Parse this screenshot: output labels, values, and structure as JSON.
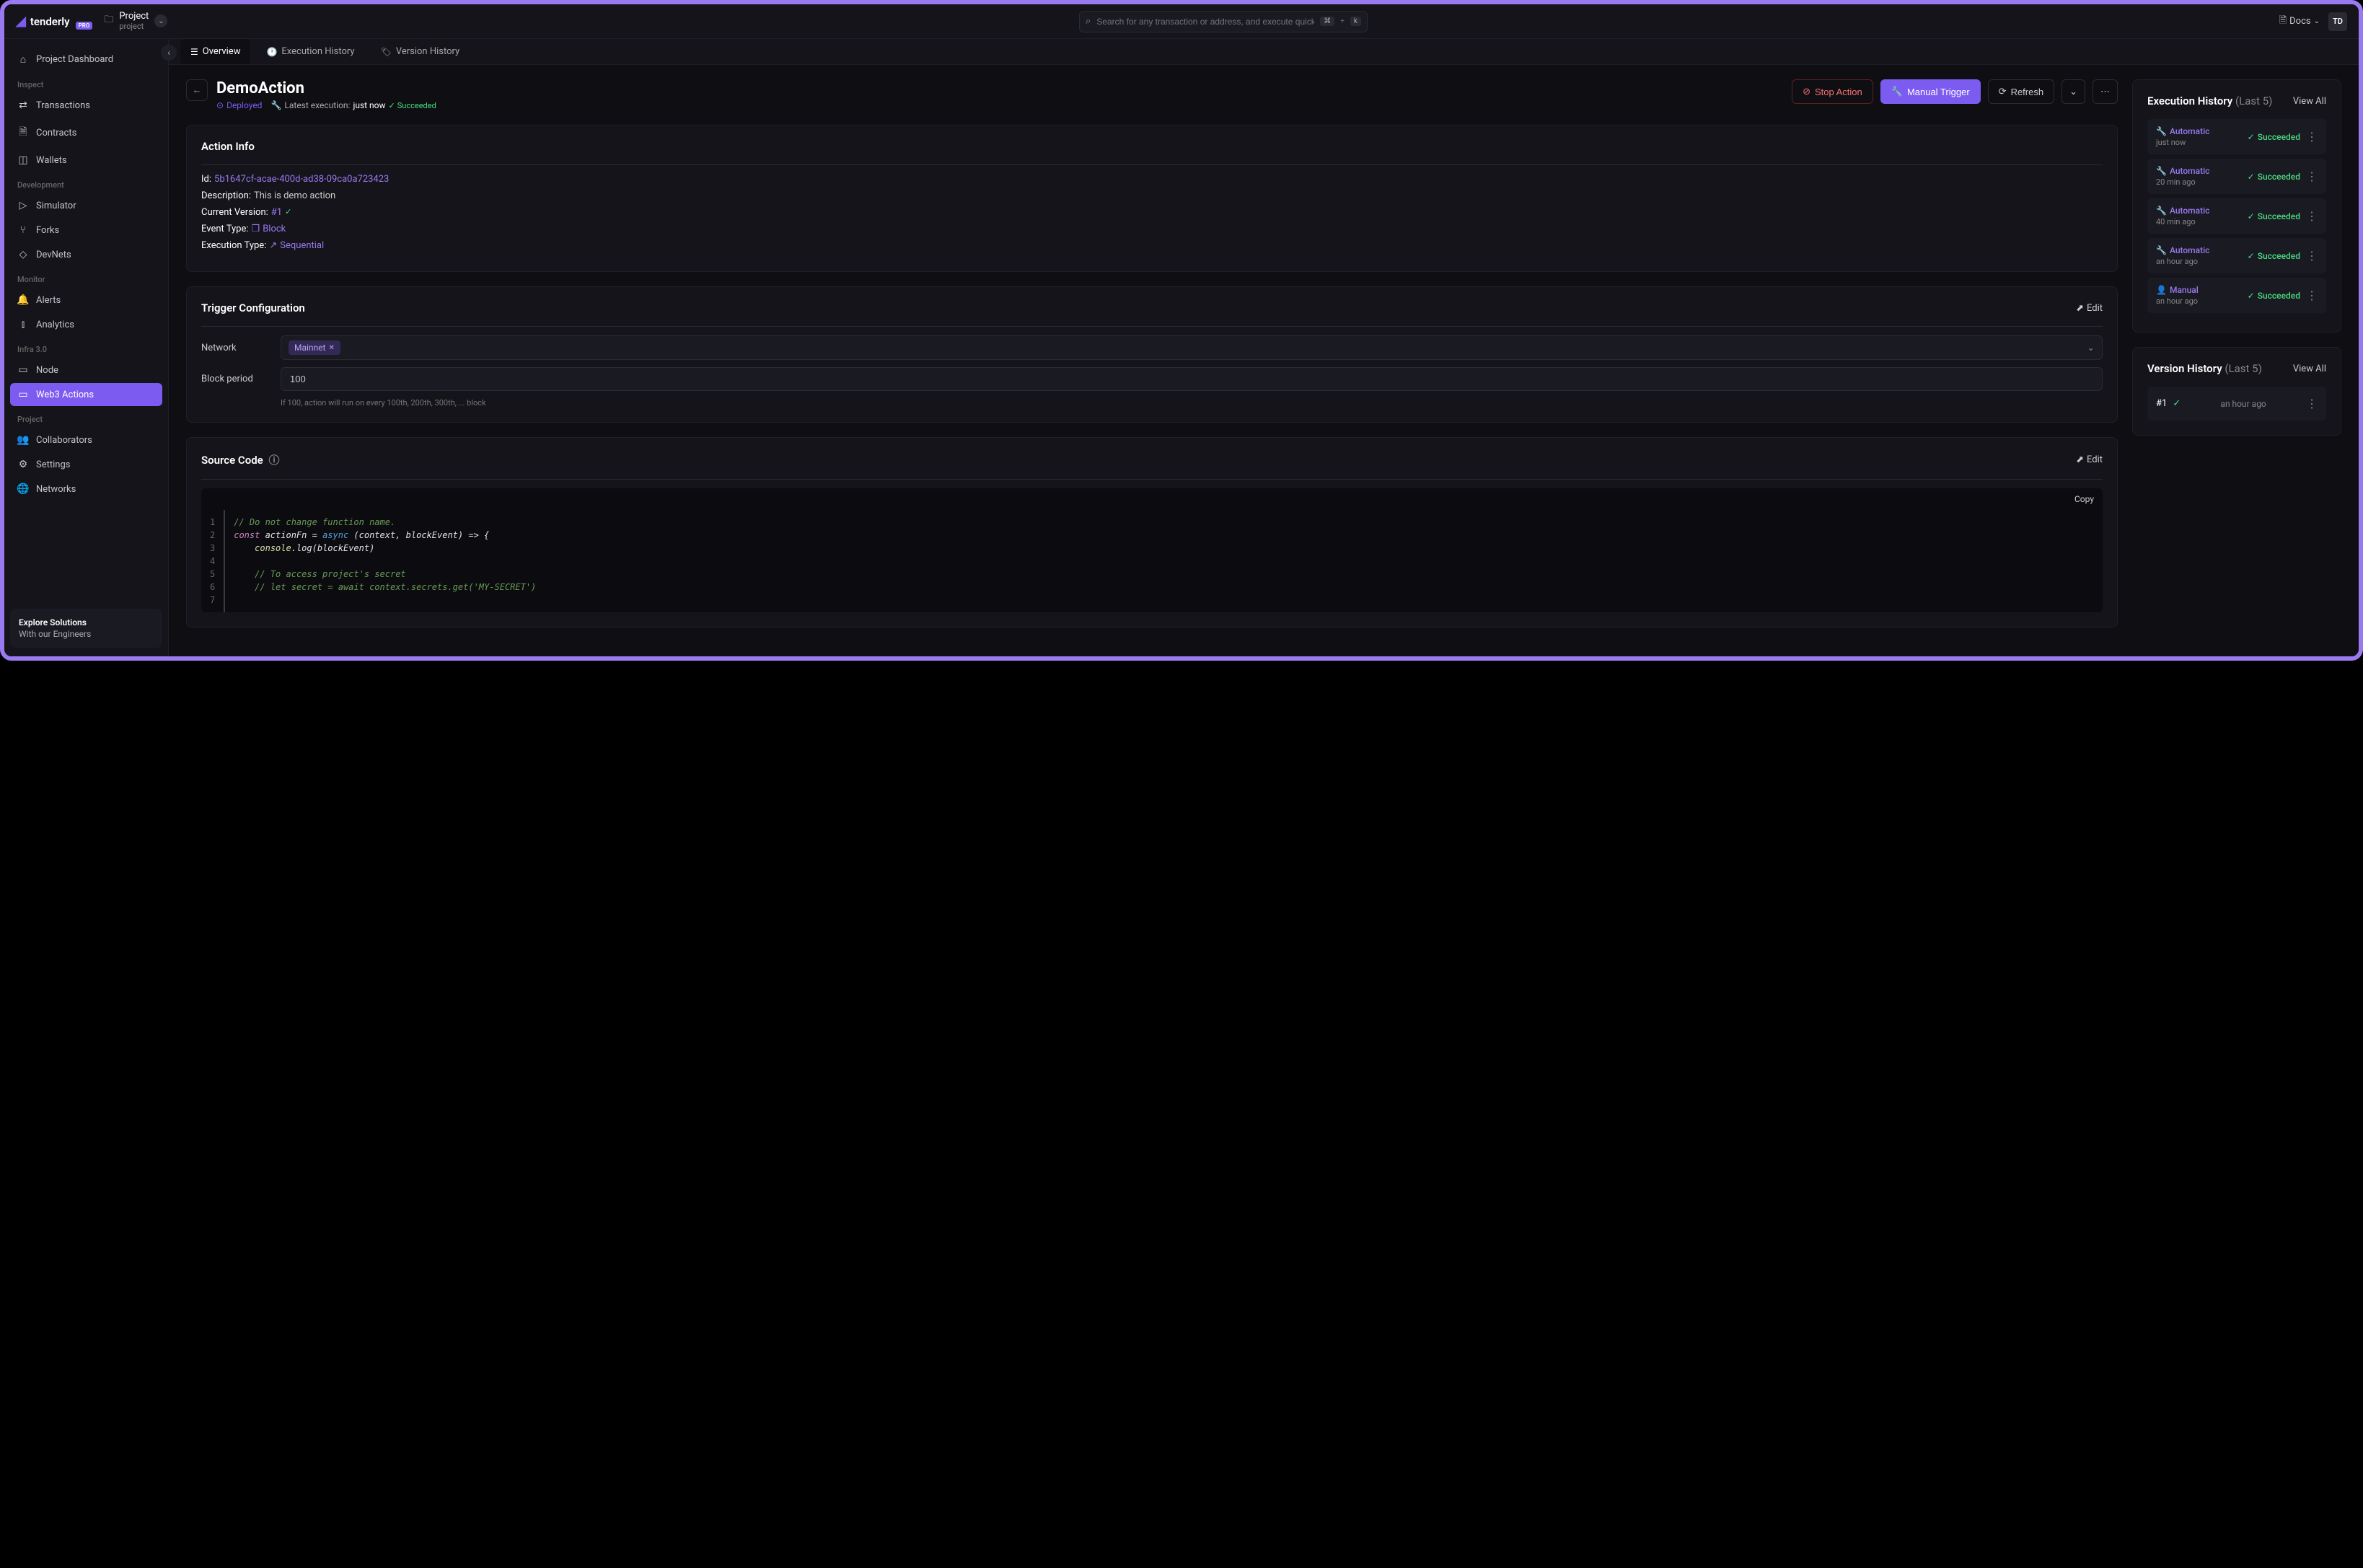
{
  "app": {
    "name": "tenderly",
    "pro": "PRO"
  },
  "project": {
    "title": "Project",
    "sub": "project"
  },
  "search": {
    "placeholder": "Search for any transaction or address, and execute quick c...",
    "kbd1": "⌘",
    "kbd2": "+",
    "kbd3": "k"
  },
  "topbar": {
    "docs": "Docs",
    "avatar": "TD"
  },
  "sidebar": {
    "dashboard": "Project Dashboard",
    "sections": {
      "inspect": "Inspect",
      "development": "Development",
      "monitor": "Monitor",
      "infra": "Infra 3.0",
      "project": "Project"
    },
    "items": {
      "transactions": "Transactions",
      "contracts": "Contracts",
      "wallets": "Wallets",
      "simulator": "Simulator",
      "forks": "Forks",
      "devnets": "DevNets",
      "alerts": "Alerts",
      "analytics": "Analytics",
      "node": "Node",
      "web3actions": "Web3 Actions",
      "collaborators": "Collaborators",
      "settings": "Settings",
      "networks": "Networks"
    },
    "explore": {
      "title": "Explore Solutions",
      "sub": "With our Engineers"
    }
  },
  "tabs": {
    "overview": "Overview",
    "execHistory": "Execution History",
    "versionHistory": "Version History"
  },
  "header": {
    "title": "DemoAction",
    "deployed": "Deployed",
    "latestPrefix": "Latest execution:",
    "latestTime": "just now",
    "succeeded": "Succeeded",
    "buttons": {
      "stop": "Stop Action",
      "manual": "Manual Trigger",
      "refresh": "Refresh"
    }
  },
  "actionInfo": {
    "title": "Action Info",
    "id_label": "Id:",
    "id_value": "5b1647cf-acae-400d-ad38-09ca0a723423",
    "desc_label": "Description:",
    "desc_value": "This is demo action",
    "version_label": "Current Version:",
    "version_value": "#1",
    "event_label": "Event Type:",
    "event_value": "Block",
    "exec_label": "Execution Type:",
    "exec_value": "Sequential"
  },
  "trigger": {
    "title": "Trigger Configuration",
    "edit": "Edit",
    "network_label": "Network",
    "network_chip": "Mainnet",
    "period_label": "Block period",
    "period_value": "100",
    "hint": "If 100, action will run on every 100th, 200th, 300th, ... block"
  },
  "source": {
    "title": "Source Code",
    "edit": "Edit",
    "copy": "Copy"
  },
  "execHistory": {
    "title": "Execution History",
    "subtitle": "(Last 5)",
    "viewAll": "View All",
    "items": [
      {
        "type": "Automatic",
        "time": "just now",
        "status": "Succeeded"
      },
      {
        "type": "Automatic",
        "time": "20 min ago",
        "status": "Succeeded"
      },
      {
        "type": "Automatic",
        "time": "40 min ago",
        "status": "Succeeded"
      },
      {
        "type": "Automatic",
        "time": "an hour ago",
        "status": "Succeeded"
      },
      {
        "type": "Manual",
        "time": "an hour ago",
        "status": "Succeeded"
      }
    ]
  },
  "versionHistory": {
    "title": "Version History",
    "subtitle": "(Last 5)",
    "viewAll": "View All",
    "items": [
      {
        "num": "#1",
        "time": "an hour ago"
      }
    ]
  }
}
